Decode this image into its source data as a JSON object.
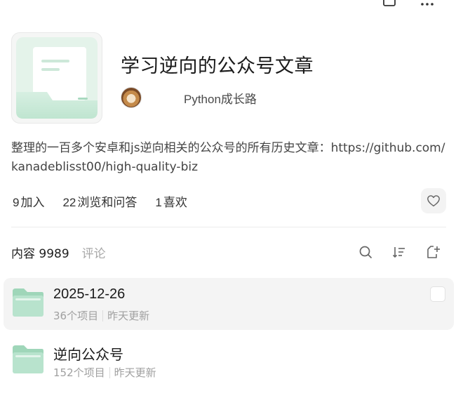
{
  "header": {
    "title": "学习逆向的公众号文章",
    "author": "Python成长路"
  },
  "description": "整理的一百多个安卓和js逆向相关的公众号的所有历史文章：https://github.com/kanadeblisst00/high-quality-biz",
  "stats": {
    "join_count": "9",
    "join_label": "加入",
    "view_count": "22",
    "view_label": "浏览和问答",
    "like_count": "1",
    "like_label": "喜欢"
  },
  "tabs": {
    "content": "内容 9989",
    "comments": "评论"
  },
  "folders": [
    {
      "name": "2025-12-26",
      "items": "36个项目",
      "updated": "昨天更新",
      "selected": true
    },
    {
      "name": "逆向公众号",
      "items": "152个项目",
      "updated": "昨天更新",
      "selected": false
    }
  ],
  "icons": {
    "share": "share-icon",
    "more": "more-icon",
    "like": "heart-icon",
    "search": "search-icon",
    "sort": "sort-icon",
    "new_folder": "new-folder-icon"
  },
  "colors": {
    "folder_green": "#b8e3cd",
    "folder_green_dark": "#9fd6b9",
    "muted_text": "#a0a0a0"
  }
}
